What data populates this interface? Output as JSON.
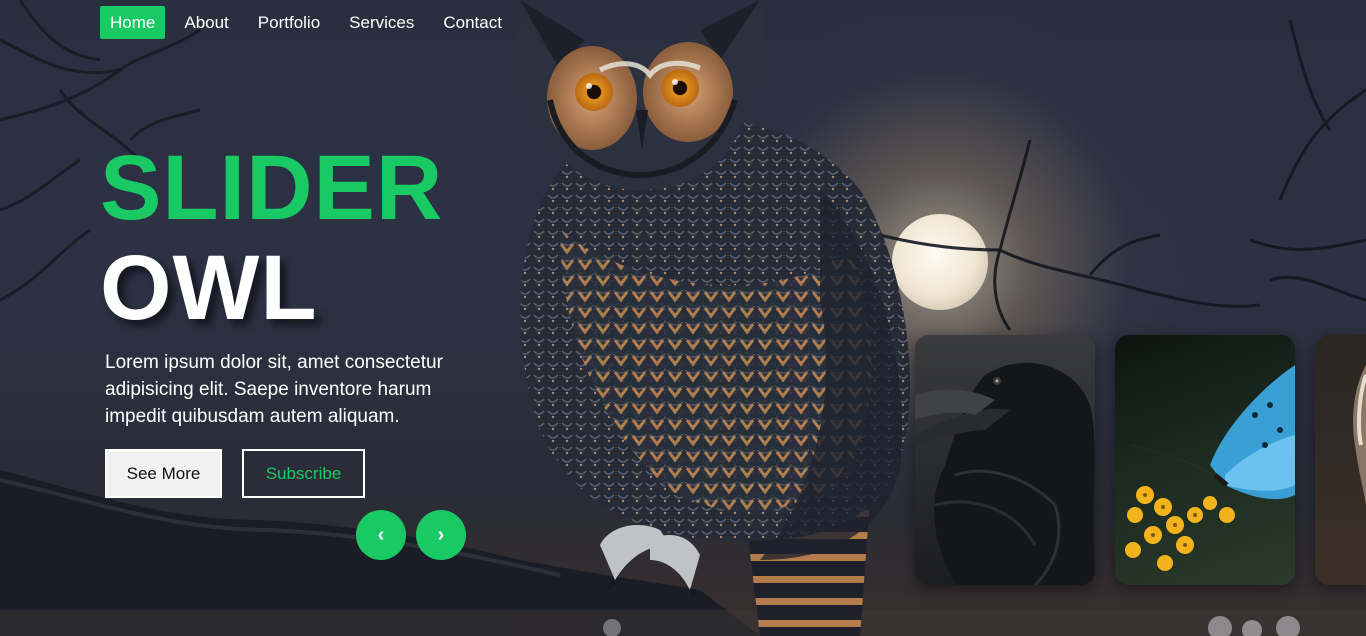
{
  "nav": {
    "items": [
      {
        "label": "Home",
        "active": true
      },
      {
        "label": "About",
        "active": false
      },
      {
        "label": "Portfolio",
        "active": false
      },
      {
        "label": "Services",
        "active": false
      },
      {
        "label": "Contact",
        "active": false
      }
    ]
  },
  "hero": {
    "title_line1": "SLIDER",
    "title_line2": "OWL",
    "description": "Lorem ipsum dolor sit, amet consectetur adipisicing elit. Saepe inventore harum impedit quibusdam autem aliquam.",
    "see_more_label": "See More",
    "subscribe_label": "Subscribe",
    "prev_label": "‹",
    "next_label": "›"
  },
  "thumbnails": [
    {
      "subject": "raven"
    },
    {
      "subject": "blue butterfly on yellow flowers"
    },
    {
      "subject": "owl"
    }
  ],
  "colors": {
    "accent": "#18c964",
    "text": "#ffffff",
    "background": "#2a2f40"
  }
}
